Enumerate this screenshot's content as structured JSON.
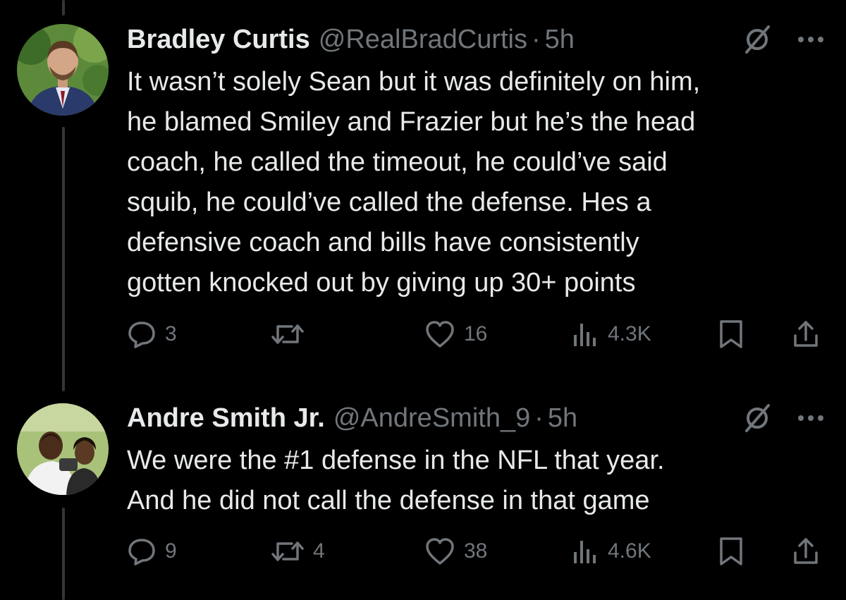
{
  "colors": {
    "background": "#000000",
    "primary_text": "#e7e9ea",
    "secondary_text": "#71767b",
    "thread_line": "#333639"
  },
  "tweets": [
    {
      "name": "Bradley Curtis",
      "handle": "@RealBradCurtis",
      "dot": "·",
      "time": "5h",
      "text_lines": [
        "It wasn’t solely Sean but it was definitely on him,",
        "he blamed Smiley and Frazier but he’s the head",
        "coach, he called the timeout, he could’ve said",
        "squib, he could’ve called the defense. Hes a",
        "defensive coach and bills have consistently",
        "gotten knocked out by giving up 30+ points"
      ],
      "replies": "3",
      "reposts": "",
      "likes": "16",
      "views": "4.3K",
      "icons": [
        "grok-icon",
        "more-icon",
        "reply-icon",
        "repost-icon",
        "like-icon",
        "views-icon",
        "bookmark-icon",
        "share-icon"
      ]
    },
    {
      "name": "Andre Smith Jr.",
      "handle": "@AndreSmith_9",
      "dot": "·",
      "time": "5h",
      "text_lines": [
        "We were the #1 defense in the NFL that year.",
        "And he did not call the defense in that game"
      ],
      "replies": "9",
      "reposts": "4",
      "likes": "38",
      "views": "4.6K",
      "icons": [
        "grok-icon",
        "more-icon",
        "reply-icon",
        "repost-icon",
        "like-icon",
        "views-icon",
        "bookmark-icon",
        "share-icon"
      ]
    }
  ]
}
